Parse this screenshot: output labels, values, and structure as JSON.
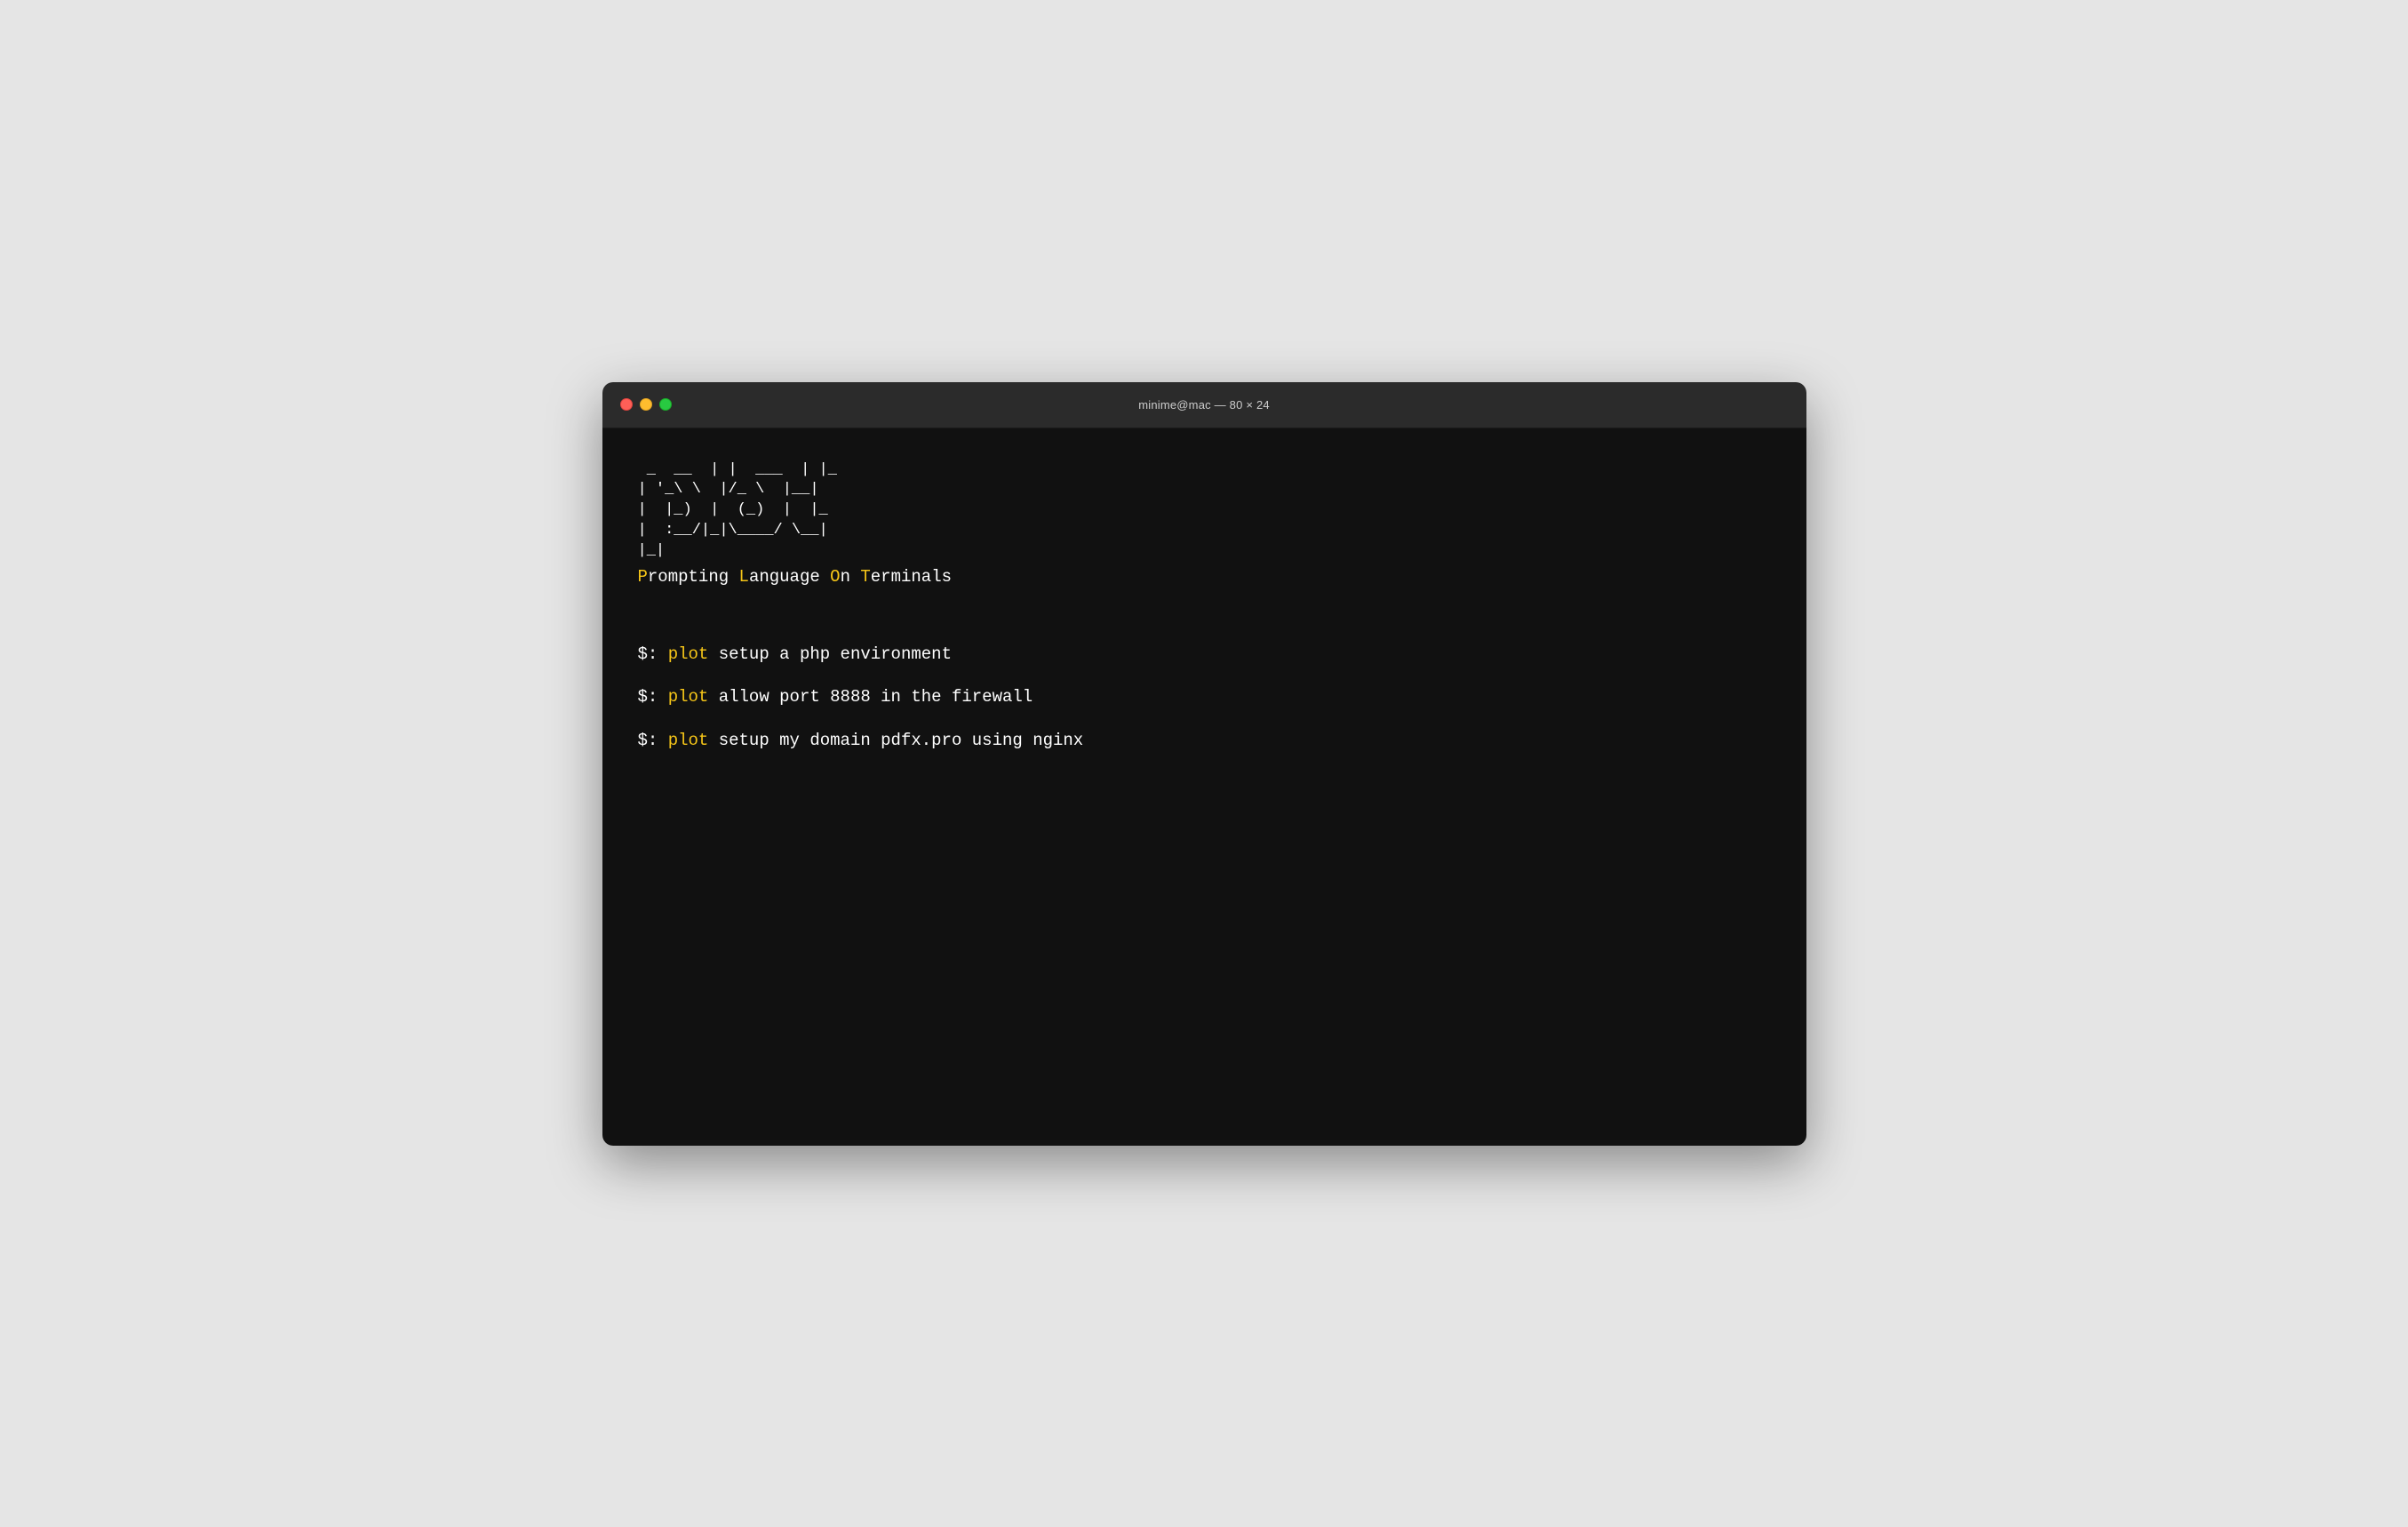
{
  "window": {
    "titlebar": {
      "title": "minime@mac — 80 × 24"
    }
  },
  "terminal": {
    "ascii_art": " _  __  | |  ___  | |_\n| '_\\ \\  | | / _\\ \\  |__|\n|  |_)  | |  (_)  |  |_\n|  :__/|_|\\____/ \\__|\n|_|",
    "tagline": {
      "p": "P",
      "rompting": "rompting ",
      "l": "L",
      "anguage": "anguage ",
      "o": "O",
      "n": "n ",
      "t": "T",
      "erminals": "erminals"
    },
    "commands": [
      {
        "prompt": "$: ",
        "cmd": "plot",
        "args": " setup a php environment"
      },
      {
        "prompt": "$: ",
        "cmd": "plot",
        "args": " allow port 8888 in the firewall"
      },
      {
        "prompt": "$: ",
        "cmd": "plot",
        "args": " setup my domain pdfx.pro using nginx"
      }
    ]
  },
  "colors": {
    "yellow": "#f5c518",
    "white": "#ffffff",
    "bg": "#111111",
    "titlebar_bg": "#2b2b2b",
    "close": "#ff5f57",
    "minimize": "#ffbd2e",
    "maximize": "#28ca41"
  }
}
